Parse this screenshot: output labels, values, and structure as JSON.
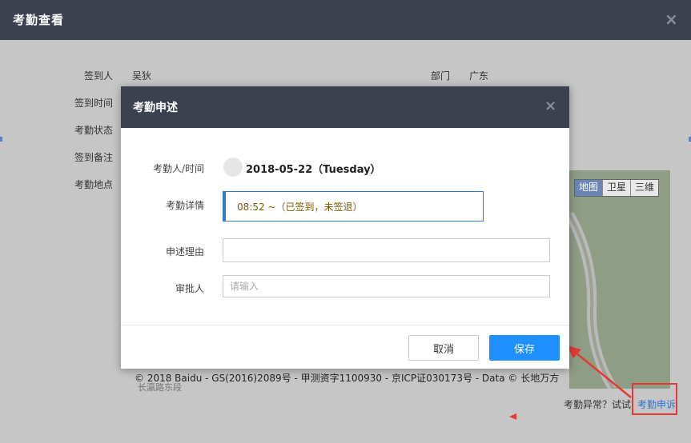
{
  "window": {
    "title": "考勤查看",
    "close_glyph": "×"
  },
  "fields": {
    "signer_label": "签到人",
    "signer_value": "吴狄",
    "dept_label": "部门",
    "dept_value": "广东",
    "time_label": "签到时间",
    "status_label": "考勤状态",
    "remark_label": "签到备注",
    "location_label": "考勤地点"
  },
  "map": {
    "buttons": [
      "地图",
      "卫星",
      "三维"
    ],
    "active": "地图",
    "copyright": "© 2018 Baidu - GS(2016)2089号 - 甲测资字1100930 - 京ICP证030173号 - Data © 长地万方",
    "copyright_sub": "长瀛路东段"
  },
  "footer": {
    "hint": "考勤异常？试试",
    "link": "考勤申诉"
  },
  "modal": {
    "title": "考勤申述",
    "close_glyph": "×",
    "person_time_label": "考勤人/时间",
    "person_time_value": "2018-05-22（Tuesday）",
    "detail_label": "考勤详情",
    "detail_value": "08:52 ~（已签到，未签退）",
    "reason_label": "申述理由",
    "reason_value": "",
    "approver_label": "审批人",
    "approver_placeholder": "请输入",
    "cancel_label": "取消",
    "save_label": "保存"
  },
  "colors": {
    "header": "#3c4150",
    "primary": "#1e90ff",
    "highlight": "#e53935"
  }
}
